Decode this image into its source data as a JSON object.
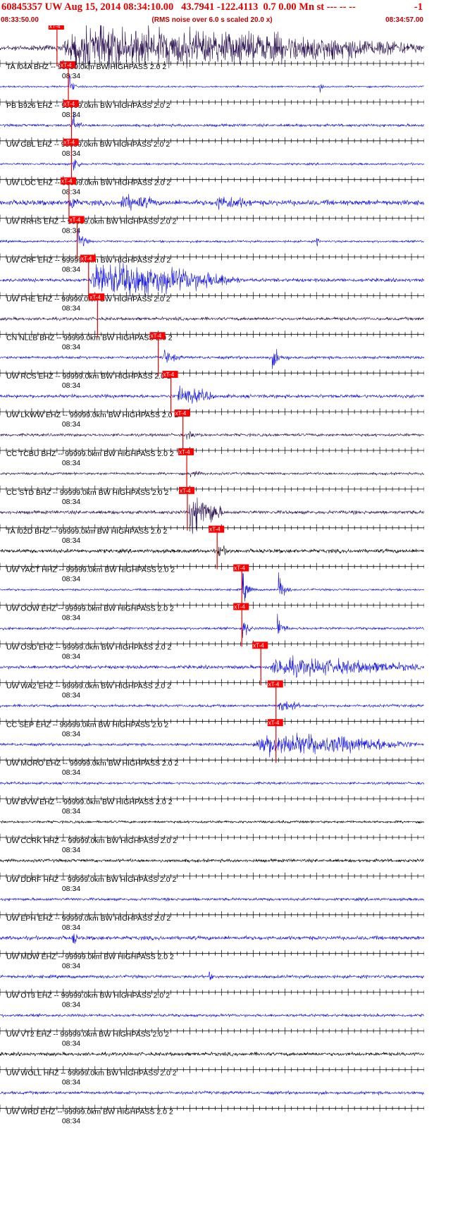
{
  "header": {
    "title": "60845357 UW Aug 15, 2014 08:34:10.00   43.7941 -122.4113  0.7 0.00 Mn st --- -- --   -1",
    "title_left": "60845357 UW Aug 15, 2014 08:34:10.00   43.7941 -122.4113  0.7 0.00 Mn st --- -- --",
    "title_right": "-1",
    "start_time": "08:33:50.00",
    "scale_note": "(RMS noise over 6.0 s scaled 20.0 x)",
    "end_time": "08:34:57.00",
    "title_color": "#e00000"
  },
  "colors": {
    "blue": "#1010e0",
    "black": "#000000",
    "navy": "#2a1050",
    "pick": "#e00000",
    "pick_box": "#ff0000"
  },
  "chart_data": {
    "type": "line",
    "time_range": [
      "08:33:50.00",
      "08:34:57.00"
    ],
    "x_duration_s": 67,
    "minute_label": "08:34",
    "minute_offset_s": 10,
    "origin_time": "08:34:10.00",
    "pick_label": "xT-4",
    "traces": [
      {
        "station": "TA.I04A.BHZ",
        "label": "TA I04A BHZ -- 99999.0km BW  HIGHPASS  2.0  2",
        "color": "navy",
        "pick_s": 9.0,
        "noise": 0.3,
        "events": [
          {
            "t": 9.5,
            "dur": 58,
            "amp": 2.2
          }
        ]
      },
      {
        "station": "PB.B926.EHZ",
        "label": "PB B926 EHZ -- 99999.0km BW  HIGHPASS  2.0  2",
        "color": "blue",
        "pick_s": 10.8,
        "noise": 0.1,
        "events": [
          {
            "t": 10.9,
            "dur": 1.2,
            "amp": 2.0
          },
          {
            "t": 50.5,
            "dur": 1.0,
            "amp": 0.6
          }
        ]
      },
      {
        "station": "UW.GBL.EHZ",
        "label": "UW GBL EHZ -- 99999.0km BW  HIGHPASS  2.0  2",
        "color": "blue",
        "pick_s": 11.3,
        "noise": 0.16,
        "events": [
          {
            "t": 11.4,
            "dur": 1.5,
            "amp": 2.1
          }
        ]
      },
      {
        "station": "UW.LOC.EHZ",
        "label": "UW LOC EHZ -- 99999.0km BW  HIGHPASS  2.0  2",
        "color": "blue",
        "pick_s": 11.3,
        "noise": 0.12,
        "events": [
          {
            "t": 11.5,
            "dur": 1.5,
            "amp": 2.0
          }
        ]
      },
      {
        "station": "UW.RRHS.EHZ",
        "label": "UW RRHS EHZ -- 99999.0km BW  HIGHPASS  2.0  2",
        "color": "blue",
        "pick_s": 10.9,
        "noise": 0.3,
        "events": [
          {
            "t": 11.0,
            "dur": 1.5,
            "amp": 1.8
          },
          {
            "t": 19.0,
            "dur": 6.0,
            "amp": 0.7
          },
          {
            "t": 34.0,
            "dur": 6.0,
            "amp": 0.6
          }
        ]
      },
      {
        "station": "UW.CRF.EHZ",
        "label": "UW CRF EHZ -- 99999.0km BW  HIGHPASS  2.0  2",
        "color": "blue",
        "pick_s": 12.2,
        "noise": 0.12,
        "events": [
          {
            "t": 12.3,
            "dur": 2.0,
            "amp": 1.8
          },
          {
            "t": 50.0,
            "dur": 0.8,
            "amp": 0.6
          }
        ]
      },
      {
        "station": "UW.FHE.EHZ",
        "label": "UW FHE EHZ -- 99999.0km BW  HIGHPASS  2.0  2",
        "color": "blue",
        "pick_s": 14.0,
        "noise": 0.2,
        "events": [
          {
            "t": 14.2,
            "dur": 24.0,
            "amp": 1.9
          }
        ]
      },
      {
        "station": "CN.NLLB.BHZ",
        "label": "CN NLLB BHZ -- 99999.0km BW  HIGHPASS  2.0  2",
        "color": "navy",
        "pick_s": 15.4,
        "noise": 0.18,
        "events": []
      },
      {
        "station": "UW.RCS.EHZ",
        "label": "UW RCS EHZ -- 99999.0km BW  HIGHPASS  2.0  2",
        "color": "blue",
        "pick_s": 25.0,
        "noise": 0.16,
        "events": [
          {
            "t": 25.8,
            "dur": 3.0,
            "amp": 1.1
          },
          {
            "t": 43.0,
            "dur": 3.0,
            "amp": 1.2
          }
        ]
      },
      {
        "station": "UW.LKWW.EHZ",
        "label": "UW LKWW EHZ -- 99999.0km BW  HIGHPASS  2.0  2",
        "color": "blue",
        "pick_s": 27.0,
        "noise": 0.2,
        "events": [
          {
            "t": 28.0,
            "dur": 6.0,
            "amp": 0.9
          }
        ]
      },
      {
        "station": "CC.TCBU.BHZ",
        "label": "CC TCBU BHZ -- 99999.0km BW  HIGHPASS  2.0  2",
        "color": "navy",
        "pick_s": 28.9,
        "noise": 0.16,
        "events": [
          {
            "t": 29.5,
            "dur": 3.0,
            "amp": 0.5
          }
        ]
      },
      {
        "station": "CC.STD.BHZ",
        "label": "CC STD BHZ -- 99999.0km BW  HIGHPASS  2.0  2",
        "color": "navy",
        "pick_s": 29.5,
        "noise": 0.14,
        "events": [
          {
            "t": 30.0,
            "dur": 3.0,
            "amp": 0.4
          }
        ]
      },
      {
        "station": "TA.I02D.BHZ",
        "label": "TA I02D BHZ -- 99999.0km BW  HIGHPASS  2.0  2",
        "color": "navy",
        "pick_s": 29.6,
        "noise": 0.2,
        "events": [
          {
            "t": 29.8,
            "dur": 5.5,
            "amp": 2.1
          }
        ]
      },
      {
        "station": "UW.YACT.HHZ",
        "label": "UW YACT HHZ -- 99999.0km BW  HIGHPASS  2.0  2",
        "color": "black",
        "pick_s": 34.3,
        "noise": 0.22,
        "events": [
          {
            "t": 34.5,
            "dur": 2.0,
            "amp": 1.0
          }
        ]
      },
      {
        "station": "UW.OOW.EHZ",
        "label": "UW OOW EHZ -- 99999.0km BW  HIGHPASS  2.0  2",
        "color": "blue",
        "pick_s": 38.2,
        "noise": 0.12,
        "events": [
          {
            "t": 38.3,
            "dur": 2.0,
            "amp": 2.0
          },
          {
            "t": 44.0,
            "dur": 2.0,
            "amp": 2.1
          }
        ]
      },
      {
        "station": "UW.OSD.EHZ",
        "label": "UW OSD EHZ -- 99999.0km BW  HIGHPASS  2.0  2",
        "color": "blue",
        "pick_s": 38.2,
        "noise": 0.14,
        "events": [
          {
            "t": 38.3,
            "dur": 2.0,
            "amp": 1.6
          },
          {
            "t": 43.8,
            "dur": 2.0,
            "amp": 1.8
          }
        ]
      },
      {
        "station": "UW.WA2.EHZ",
        "label": "UW WA2 EHZ -- 99999.0km BW  HIGHPASS  2.0  2",
        "color": "blue",
        "pick_s": 41.2,
        "noise": 0.2,
        "events": [
          {
            "t": 42.5,
            "dur": 24.0,
            "amp": 0.9
          }
        ]
      },
      {
        "station": "CC.SEP.EHZ",
        "label": "CC SEP EHZ -- 99999.0km BW  HIGHPASS  2.0  2",
        "color": "blue",
        "pick_s": 43.6,
        "noise": 0.16,
        "events": [
          {
            "t": 43.8,
            "dur": 4.0,
            "amp": 0.6
          }
        ]
      },
      {
        "station": "UW.MORO.EHZ",
        "label": "UW MORO EHZ -- 99999.0km BW  HIGHPASS  2.0  2",
        "color": "blue",
        "pick_s": 43.6,
        "noise": 0.16,
        "events": [
          {
            "t": 40.0,
            "dur": 26.0,
            "amp": 1.2
          }
        ]
      },
      {
        "station": "UW.BVW.EHZ",
        "label": "UW BVW EHZ -- 99999.0km BW  HIGHPASS  2.0  2",
        "color": "blue",
        "pick_s": null,
        "noise": 0.14,
        "events": []
      },
      {
        "station": "UW.CCRK.HHZ",
        "label": "UW CCRK HHZ -- 99999.0km BW  HIGHPASS  2.0  2",
        "color": "black",
        "pick_s": null,
        "noise": 0.14,
        "events": []
      },
      {
        "station": "UW.DDRF.HHZ",
        "label": "UW DDRF HHZ -- 99999.0km BW  HIGHPASS  2.0  2",
        "color": "black",
        "pick_s": null,
        "noise": 0.18,
        "events": []
      },
      {
        "station": "UW.EPH.EHZ",
        "label": "UW EPH EHZ -- 99999.0km BW  HIGHPASS  2.0  2",
        "color": "blue",
        "pick_s": null,
        "noise": 0.16,
        "events": []
      },
      {
        "station": "UW.MDW.EHZ",
        "label": "UW MDW EHZ -- 99999.0km BW  HIGHPASS  2.0  2",
        "color": "blue",
        "pick_s": null,
        "noise": 0.22,
        "events": [
          {
            "t": 11.5,
            "dur": 1.0,
            "amp": 1.3
          }
        ]
      },
      {
        "station": "UW.OT3.EHZ",
        "label": "UW OT3 EHZ -- 99999.0km BW  HIGHPASS  2.0  2",
        "color": "blue",
        "pick_s": null,
        "noise": 0.18,
        "events": [
          {
            "t": 33.0,
            "dur": 1.0,
            "amp": 0.5
          }
        ]
      },
      {
        "station": "UW.VT2.EHZ",
        "label": "UW VT2 EHZ -- 99999.0km BW  HIGHPASS  2.0  2",
        "color": "blue",
        "pick_s": null,
        "noise": 0.16,
        "events": []
      },
      {
        "station": "UW.WOLL.HHZ",
        "label": "UW WOLL HHZ -- 99999.0km BW  HIGHPASS  2.0  2",
        "color": "black",
        "pick_s": null,
        "noise": 0.2,
        "events": []
      },
      {
        "station": "UW.WRD.EHZ",
        "label": "UW WRD EHZ -- 99999.0km BW  HIGHPASS  2.0  2",
        "color": "blue",
        "pick_s": null,
        "noise": 0.18,
        "events": []
      }
    ]
  }
}
